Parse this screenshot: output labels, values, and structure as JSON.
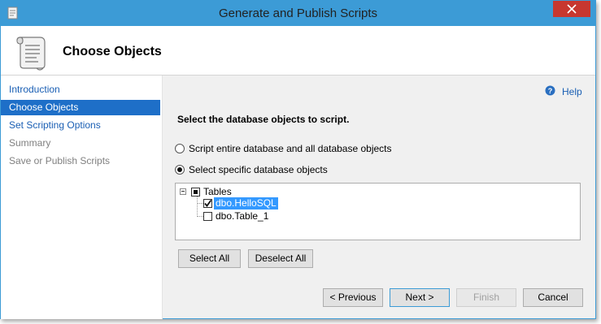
{
  "window": {
    "title": "Generate and Publish Scripts",
    "accent_color": "#3c9bd6",
    "close_color": "#c7372f",
    "icons": [
      "app-icon",
      "close-icon"
    ]
  },
  "header": {
    "title": "Choose Objects",
    "icon": "scroll-icon"
  },
  "nav": {
    "items": [
      {
        "label": "Introduction",
        "state": "link"
      },
      {
        "label": "Choose Objects",
        "state": "selected"
      },
      {
        "label": "Set Scripting Options",
        "state": "link"
      },
      {
        "label": "Summary",
        "state": "muted"
      },
      {
        "label": "Save or Publish Scripts",
        "state": "muted"
      }
    ]
  },
  "help": {
    "label": "Help",
    "icon": "help-icon"
  },
  "main": {
    "instruction": "Select the database objects to script.",
    "options": [
      {
        "label": "Script entire database and all database objects",
        "selected": false
      },
      {
        "label": "Select specific database objects",
        "selected": true
      }
    ],
    "tree": {
      "root": {
        "label": "Tables",
        "checked": "partial",
        "expanded": true
      },
      "children": [
        {
          "label": "dbo.HelloSQL",
          "checked": true,
          "highlighted": true
        },
        {
          "label": "dbo.Table_1",
          "checked": false,
          "highlighted": false
        }
      ]
    },
    "select_all_label": "Select All",
    "deselect_all_label": "Deselect All"
  },
  "footer": {
    "previous_label": "< Previous",
    "next_label": "Next >",
    "finish_label": "Finish",
    "cancel_label": "Cancel"
  }
}
